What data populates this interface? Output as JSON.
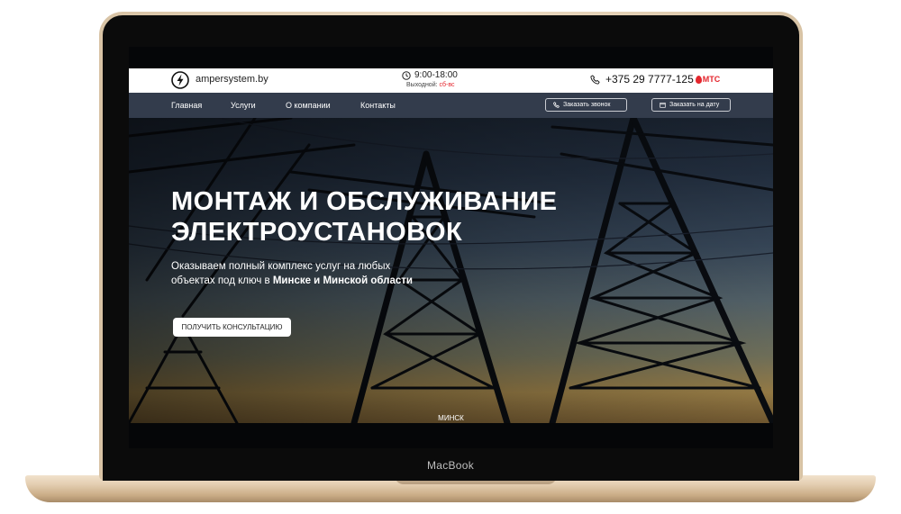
{
  "device": {
    "label": "MacBook"
  },
  "header": {
    "brand": "ampersystem.by",
    "hours": "9:00-18:00",
    "days_off_prefix": "Выходной:",
    "days_off_value": "сб-вс",
    "phone": "+375 29 7777-125",
    "operator": "МТС",
    "icons": {
      "logo": "lightning-bolt-icon",
      "clock": "clock-icon",
      "phone": "phone-icon"
    }
  },
  "nav": {
    "items": [
      "Главная",
      "Услуги",
      "О компании",
      "Контакты"
    ],
    "call_button": "Заказать звонок",
    "date_button": "Заказать на дату"
  },
  "hero": {
    "title_line1": "МОНТАЖ И ОБСЛУЖИВАНИЕ",
    "title_line2": "ЭЛЕКТРОУСТАНОВОК",
    "subtitle_line1": "Оказываем полный комплекс услуг на любых",
    "subtitle_line2_prefix": "объектах под ключ в",
    "subtitle_line2_bold": "Минске и Минской области",
    "cta": "ПОЛУЧИТЬ КОНСУЛЬТАЦИЮ",
    "city": "МИНСК"
  },
  "colors": {
    "accent_red": "#e4262d",
    "nav_bg": "#333c4c",
    "laptop_gold": "#e3cdb0"
  }
}
